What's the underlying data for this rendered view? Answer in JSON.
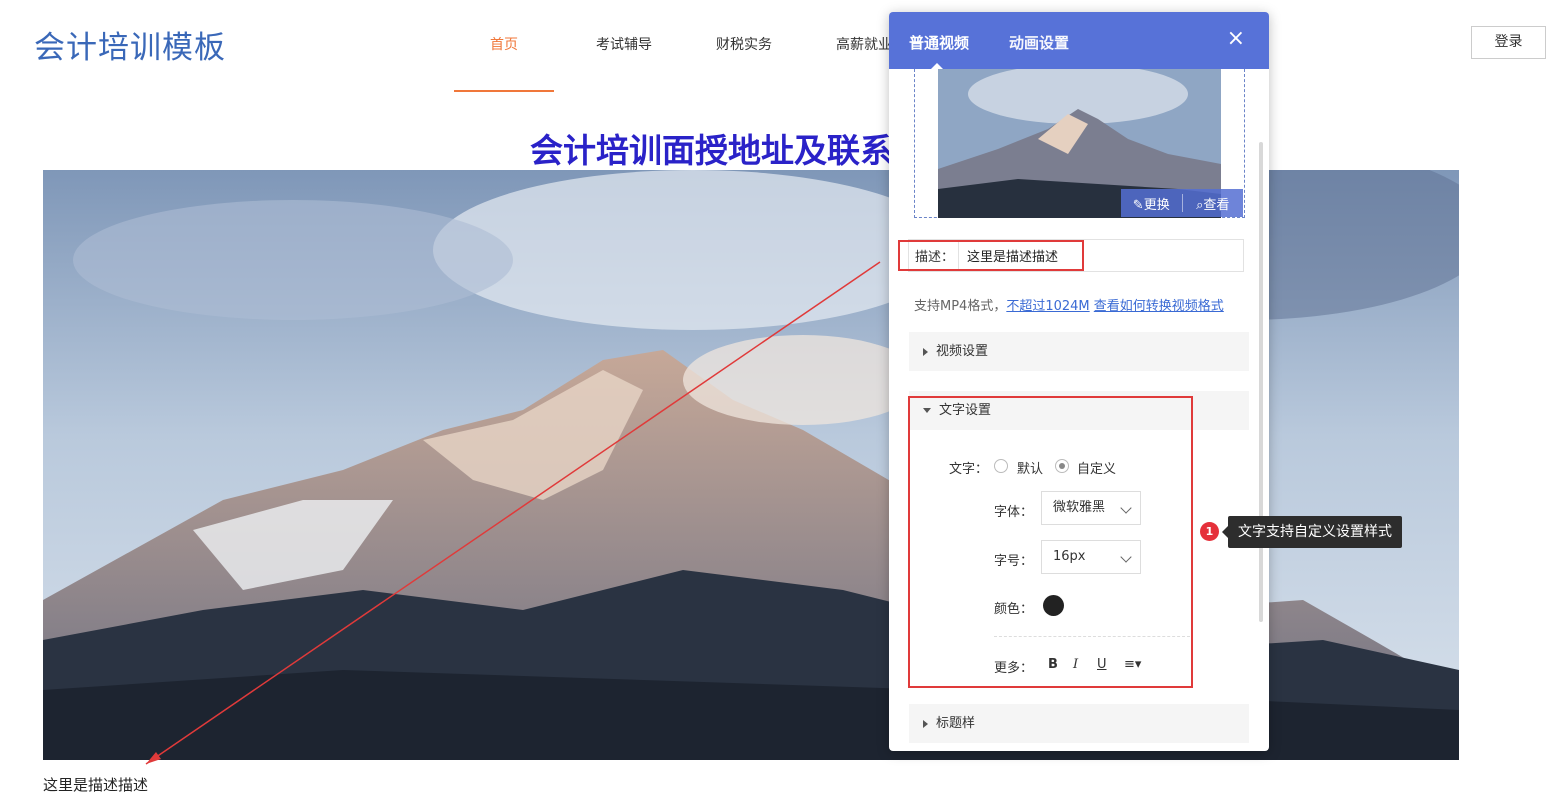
{
  "site": {
    "logo": "会计培训模板",
    "nav": [
      "首页",
      "考试辅导",
      "财税实务",
      "高薪就业"
    ],
    "login": "登录",
    "page_title": "会计培训面授地址及联系",
    "caption": "这里是描述描述"
  },
  "panel": {
    "tabs": [
      "普通视频",
      "动画设置"
    ],
    "close_icon": "×",
    "thumb_actions": {
      "replace": "更换",
      "view": "查看"
    },
    "desc_label": "描述：",
    "desc_value": "这里是描述描述",
    "support_text": "支持MP4格式，",
    "support_link1": "不超过1024M",
    "support_link2": "查看如何转换视频格式",
    "sections": {
      "video": "视频设置",
      "text": "文字设置",
      "title": "标题样"
    },
    "text_settings": {
      "text_label": "文字：",
      "option_default": "默认",
      "option_custom": "自定义",
      "font_label": "字体：",
      "font_value": "微软雅黑",
      "size_label": "字号：",
      "size_value": "16px",
      "color_label": "颜色：",
      "more_label": "更多：",
      "bold": "B",
      "italic": "I",
      "underline": "U",
      "align": "≡▾"
    }
  },
  "tooltip": {
    "badge": "1",
    "text": "文字支持自定义设置样式"
  },
  "colors": {
    "accent": "#5772d8",
    "highlight": "#e03a3a",
    "nav_active": "#f0773a",
    "title": "#2a22c8"
  }
}
